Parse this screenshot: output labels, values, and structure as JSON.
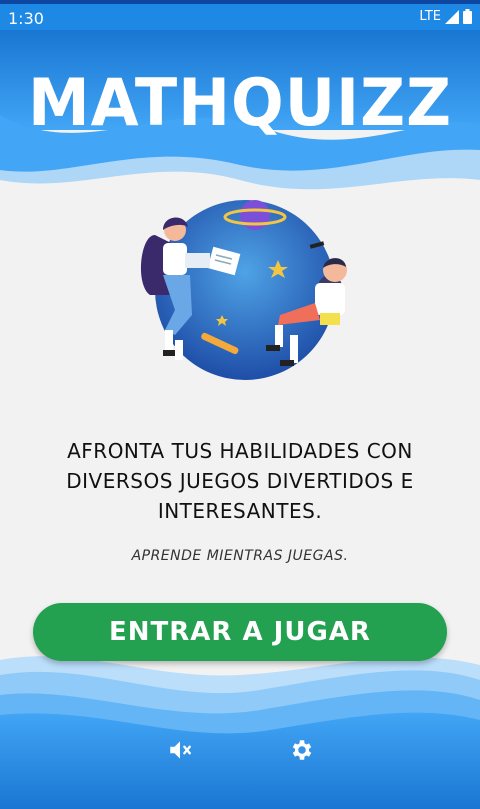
{
  "status_bar": {
    "time": "1:30",
    "network": "LTE"
  },
  "app": {
    "title": "MATHQUIZZ"
  },
  "main": {
    "headline": "AFRONTA TUS HABILIDADES CON DIVERSOS JUEGOS DIVERTIDOS E INTERESANTES.",
    "subtitle": "APRENDE MIENTRAS JUEGAS.",
    "play_label": "ENTRAR A JUGAR"
  },
  "footer": {
    "mute_icon": "volume-off-icon",
    "settings_icon": "gear-icon"
  },
  "colors": {
    "primary_blue": "#1e88e5",
    "button_green": "#23a050",
    "background": "#f2f2f2"
  }
}
